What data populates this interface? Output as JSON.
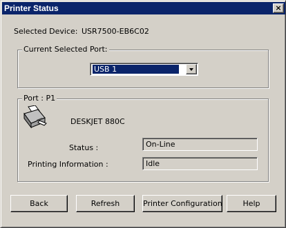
{
  "window": {
    "title": "Printer Status",
    "close_glyph": "×"
  },
  "device": {
    "label": "Selected Device:",
    "value": "USR7500-EB6C02"
  },
  "port_group": {
    "title": "Current Selected Port:",
    "selected": "USB 1"
  },
  "port_info": {
    "title": "Port : P1",
    "printer_name": "DESKJET 880C",
    "status_label": "Status :",
    "status_value": "On-Line",
    "printing_label": "Printing Information :",
    "printing_value": "Idle",
    "icon": "printer-icon"
  },
  "buttons": {
    "back": "Back",
    "refresh": "Refresh",
    "config": "Printer Configuration",
    "help": "Help"
  }
}
